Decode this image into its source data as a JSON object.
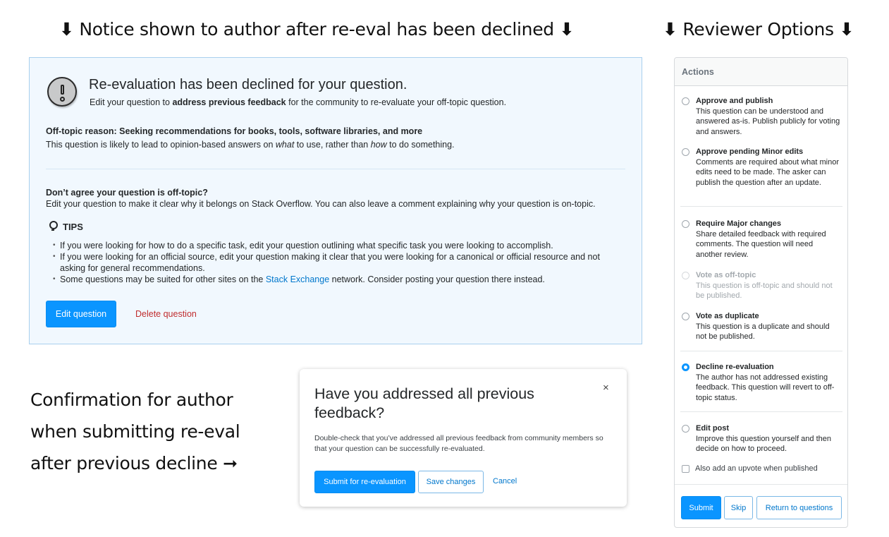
{
  "captions": {
    "notice": "Notice shown to author after re-eval has been declined",
    "reviewer": "Reviewer Options",
    "confirm": "Confirmation for author when submitting re-eval after previous decline",
    "arrow_down": "⬇",
    "arrow_right": "➞"
  },
  "notice": {
    "icon": "exclamation-circle-icon",
    "title": "Re-evaluation has been declined for your question.",
    "sub_prefix": "Edit your question to ",
    "sub_bold": "address previous feedback",
    "sub_suffix": " for the community to re-evaluate your off-topic question.",
    "reason_title": "Off-topic reason: Seeking recommendations for books, tools, software libraries, and more",
    "reason_p1": "This question is likely to lead to opinion-based answers on ",
    "reason_what": "what",
    "reason_p2": " to use, rather than ",
    "reason_how": "how",
    "reason_p3": " to do something.",
    "disagree_title": "Don’t agree your question is off-topic?",
    "disagree_body": "Edit your question to make it clear why it belongs on Stack Overflow. You can also leave a comment explaining why your question is on-topic.",
    "tips_label": "TIPS",
    "tips": [
      "If you were looking for how to do a specific task, edit your question outlining what specific task you were looking to accomplish.",
      "If you were looking for an official source, edit your question making it clear that you were looking for a canonical or official resource and not asking for general recommendations."
    ],
    "tip3_prefix": "Some questions may be suited for other sites on the ",
    "tip3_link": "Stack Exchange",
    "tip3_suffix": " network. Consider posting your question there instead.",
    "edit_button": "Edit question",
    "delete_link": "Delete question"
  },
  "modal": {
    "title": "Have you addressed all previous feedback?",
    "close": "×",
    "body": "Double-check that you’ve addressed all previous feedback from community members so that your question can be successfully re-evaluated.",
    "submit_button": "Submit for re-evaluation",
    "save_button": "Save changes",
    "cancel_link": "Cancel"
  },
  "actions": {
    "header": "Actions",
    "options": [
      {
        "title": "Approve and publish",
        "desc": "This question can be understood and answered as-is. Publish publicly for voting and answers.",
        "checked": false,
        "disabled": false
      },
      {
        "title": "Approve pending Minor edits",
        "desc": "Comments are required about what minor edits need to be made. The asker can publish the question after an update.",
        "checked": false,
        "disabled": false
      },
      {
        "title": "Require Major changes",
        "desc": "Share detailed feedback with required comments. The question will need another review.",
        "checked": false,
        "disabled": false
      },
      {
        "title": "Vote as off-topic",
        "desc": "This question is off-topic and should not be published.",
        "checked": false,
        "disabled": true
      },
      {
        "title": "Vote as duplicate",
        "desc": "This question is a duplicate and should not be published.",
        "checked": false,
        "disabled": false
      },
      {
        "title": "Decline re-evaluation",
        "desc": "The author has not addressed existing feedback. This question will revert to off-topic status.",
        "checked": true,
        "disabled": false
      },
      {
        "title": "Edit post",
        "desc": "Improve this question yourself and then decide on how to proceed.",
        "checked": false,
        "disabled": false
      }
    ],
    "upvote_checkbox": "Also add an upvote when published",
    "upvote_checked": false,
    "submit_button": "Submit",
    "skip_button": "Skip",
    "return_button": "Return to questions"
  },
  "colors": {
    "accent": "#0a95ff",
    "link": "#0077cc",
    "danger": "#c02d2e",
    "notice_bg": "#f1f8fe"
  }
}
